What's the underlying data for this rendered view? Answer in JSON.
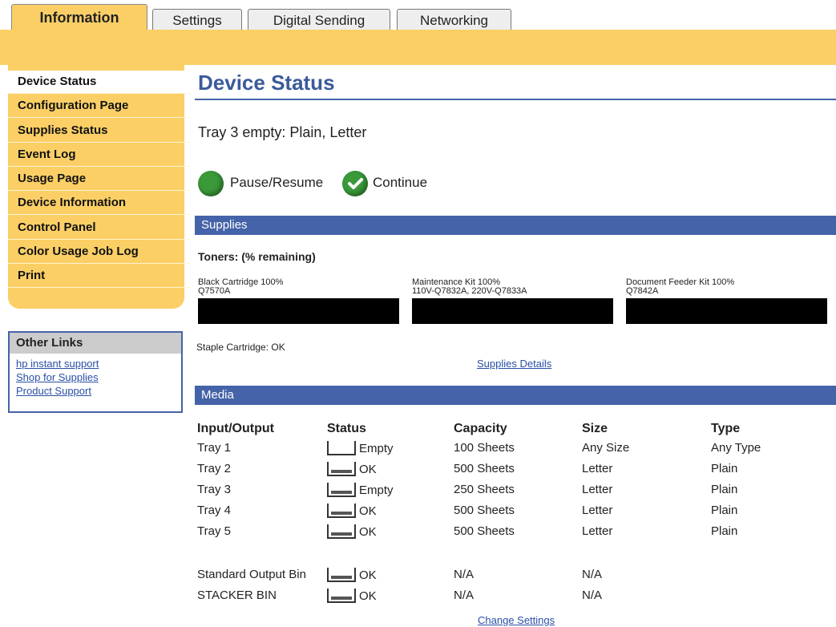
{
  "tabs": [
    {
      "label": "Information",
      "active": true
    },
    {
      "label": "Settings",
      "active": false
    },
    {
      "label": "Digital Sending",
      "active": false
    },
    {
      "label": "Networking",
      "active": false
    }
  ],
  "sidebar": {
    "items": [
      {
        "label": "Device Status",
        "active": true
      },
      {
        "label": "Configuration Page"
      },
      {
        "label": "Supplies Status"
      },
      {
        "label": "Event Log"
      },
      {
        "label": "Usage Page"
      },
      {
        "label": "Device Information"
      },
      {
        "label": "Control Panel"
      },
      {
        "label": "Color Usage Job Log"
      },
      {
        "label": "Print"
      }
    ]
  },
  "other_links": {
    "title": "Other Links",
    "links": [
      "hp instant support",
      "Shop for Supplies",
      "Product Support"
    ]
  },
  "page": {
    "title": "Device Status",
    "status_message": "Tray 3 empty: Plain, Letter",
    "pause_resume_label": "Pause/Resume",
    "continue_label": "Continue"
  },
  "supplies": {
    "section_title": "Supplies",
    "toners_heading": "Toners: (% remaining)",
    "cartridges": [
      {
        "name": "Black Cartridge  100%",
        "part": "Q7570A",
        "percent": 100
      },
      {
        "name": "Maintenance Kit  100%",
        "part": "110V-Q7832A, 220V-Q7833A",
        "percent": 100
      },
      {
        "name": "Document Feeder Kit  100%",
        "part": "Q7842A",
        "percent": 100
      }
    ],
    "staple": "Staple Cartridge: OK",
    "details_link": "Supplies Details"
  },
  "media": {
    "section_title": "Media",
    "headers": [
      "Input/Output",
      "Status",
      "Capacity",
      "Size",
      "Type"
    ],
    "rows": [
      {
        "io": "Tray 1",
        "status": "Empty",
        "full": false,
        "capacity": "100 Sheets",
        "size": "Any Size",
        "type": "Any Type"
      },
      {
        "io": "Tray 2",
        "status": "OK",
        "full": true,
        "capacity": "500 Sheets",
        "size": "Letter",
        "type": "Plain"
      },
      {
        "io": "Tray 3",
        "status": "Empty",
        "full": true,
        "capacity": "250 Sheets",
        "size": "Letter",
        "type": "Plain"
      },
      {
        "io": "Tray 4",
        "status": "OK",
        "full": true,
        "capacity": "500 Sheets",
        "size": "Letter",
        "type": "Plain"
      },
      {
        "io": "Tray 5",
        "status": "OK",
        "full": true,
        "capacity": "500 Sheets",
        "size": "Letter",
        "type": "Plain"
      },
      {
        "io": "Standard Output Bin",
        "status": "OK",
        "full": true,
        "capacity": "N/A",
        "size": "N/A",
        "type": ""
      },
      {
        "io": "STACKER BIN",
        "status": "OK",
        "full": true,
        "capacity": "N/A",
        "size": "N/A",
        "type": ""
      }
    ],
    "change_link": "Change Settings"
  },
  "colors": {
    "accent": "#fbcf66",
    "blue": "#4563a8",
    "green": "#3a9a3a"
  }
}
